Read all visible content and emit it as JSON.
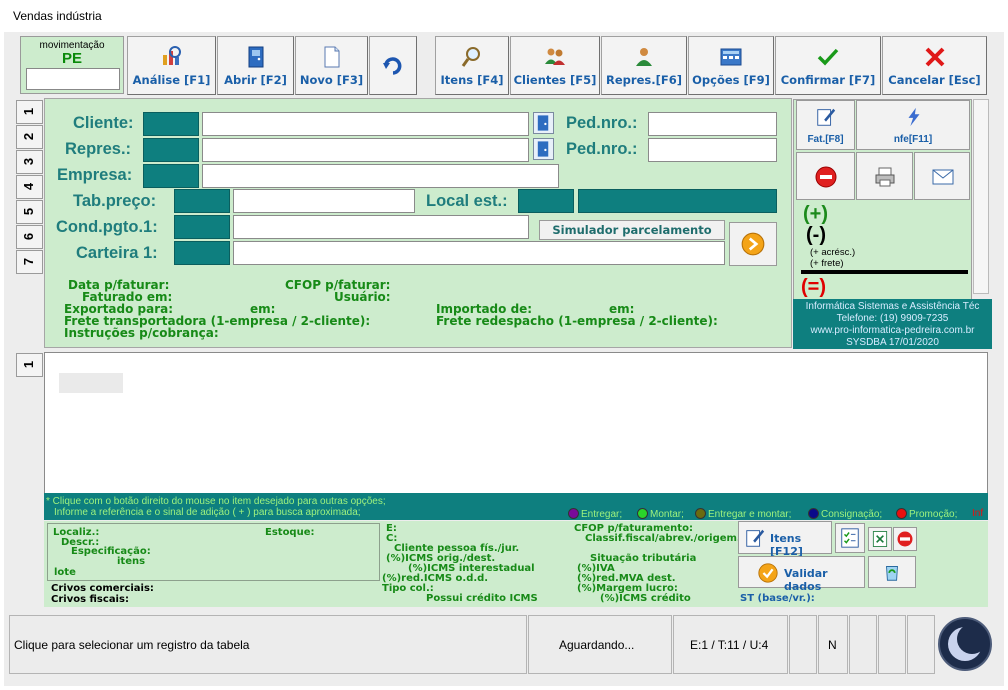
{
  "window": {
    "title": "Vendas indústria"
  },
  "movimentacao": {
    "label": "movimentação",
    "code": "PE",
    "value": ""
  },
  "toolbar": {
    "analise": "Análise [F1]",
    "abrir": "Abrir [F2]",
    "novo": "Novo [F3]",
    "itens": "Itens [F4]",
    "clientes": "Clientes [F5]",
    "repres": "Repres.[F6]",
    "opcoes": "Opções [F9]",
    "confirmar": "Confirmar [F7]",
    "cancelar": "Cancelar [Esc]"
  },
  "tabs": [
    "1",
    "2",
    "3",
    "4",
    "5",
    "6",
    "7"
  ],
  "grid_tab": "1",
  "form": {
    "cliente": "Cliente:",
    "repres": "Repres.:",
    "empresa": "Empresa:",
    "ped_nro_1": "Ped.nro.:",
    "ped_nro_2": "Ped.nro.:",
    "tab_preco": "Tab.preço:",
    "local_est": "Local est.:",
    "cond_pgto": "Cond.pgto.1:",
    "carteira": "Carteira 1:",
    "simulador": "Simulador parcelamento"
  },
  "info": {
    "data_faturar": "Data p/faturar:",
    "faturado_em": "Faturado em:",
    "exportado_para": "Exportado para:",
    "em1": "em:",
    "frete_transp": "Frete transportadora (1-empresa / 2-cliente):",
    "instrucoes": "Instruções p/cobrança:",
    "cfop_faturar": "CFOP p/faturar:",
    "usuario": "Usuário:",
    "importado_de": "Importado de:",
    "em2": "em:",
    "frete_redesp": "Frete redespacho (1-empresa / 2-cliente):"
  },
  "right_panel": {
    "fat": "Fat.[F8]",
    "nfe": "nfe[F11]",
    "plus": "(+)",
    "minus": "(-)",
    "acresc": "(+ acrésc.)",
    "frete": "(+ frete)",
    "equals": "(=)",
    "company_name": "Informática Sistemas e Assistência Téc",
    "phone": "Telefone: (19) 9909-7235",
    "site": "www.pro-informatica-pedreira.com.br",
    "sys": "SYSDBA 17/01/2020"
  },
  "legend": {
    "hint1": "* Clique com o botão direito do mouse no item desejado para outras opções;",
    "hint2": "Informe a referência e o sinal de adição ( + ) para busca aproximada;",
    "items": [
      {
        "label": "Entregar;",
        "color": "#7a0a9a"
      },
      {
        "label": "Montar;",
        "color": "#2ad42a"
      },
      {
        "label": "Entregar e montar;",
        "color": "#6b6b10"
      },
      {
        "label": "Consignação;",
        "color": "#0a0a8a"
      },
      {
        "label": "Promoção;",
        "color": "#e81010"
      }
    ],
    "trail": "Inf"
  },
  "details": {
    "localiz": "Localiz.:",
    "descr": "Descr.:",
    "especificacao": "Especificação:",
    "itens": "itens",
    "lote": "lote",
    "estoque": "Estoque:",
    "crivos_comerciais": "Crivos comerciais:",
    "crivos_fiscais": "Crivos fiscais:",
    "e": "E:",
    "c": "C:",
    "cliente_pessoa": "Cliente pessoa fís./jur.",
    "icms_orig": "(%)ICMS orig./dest.",
    "icms_inter": "(%)ICMS interestadual",
    "red_icms": "(%)red.ICMS o.d.d.",
    "tipo_col": "Tipo col.:",
    "possui_credito": "Possui crédito ICMS",
    "cfop_fat": "CFOP p/faturamento:",
    "classif": "Classif.fiscal/abrev./origem.",
    "situacao": "Situação tributária",
    "iva": "(%)IVA",
    "red_mva": "(%)red.MVA dest.",
    "margem": "(%)Margem lucro:",
    "icms_credito": "(%)ICMS crédito",
    "st": "ST (base/vr.):",
    "itens_btn": "Itens [F12]",
    "validar_btn": "Validar dados"
  },
  "status": {
    "hint": "Clique para selecionar  um registro da tabela",
    "state": "Aguardando...",
    "counters": "E:1 / T:11 / U:4",
    "flag": "N"
  }
}
